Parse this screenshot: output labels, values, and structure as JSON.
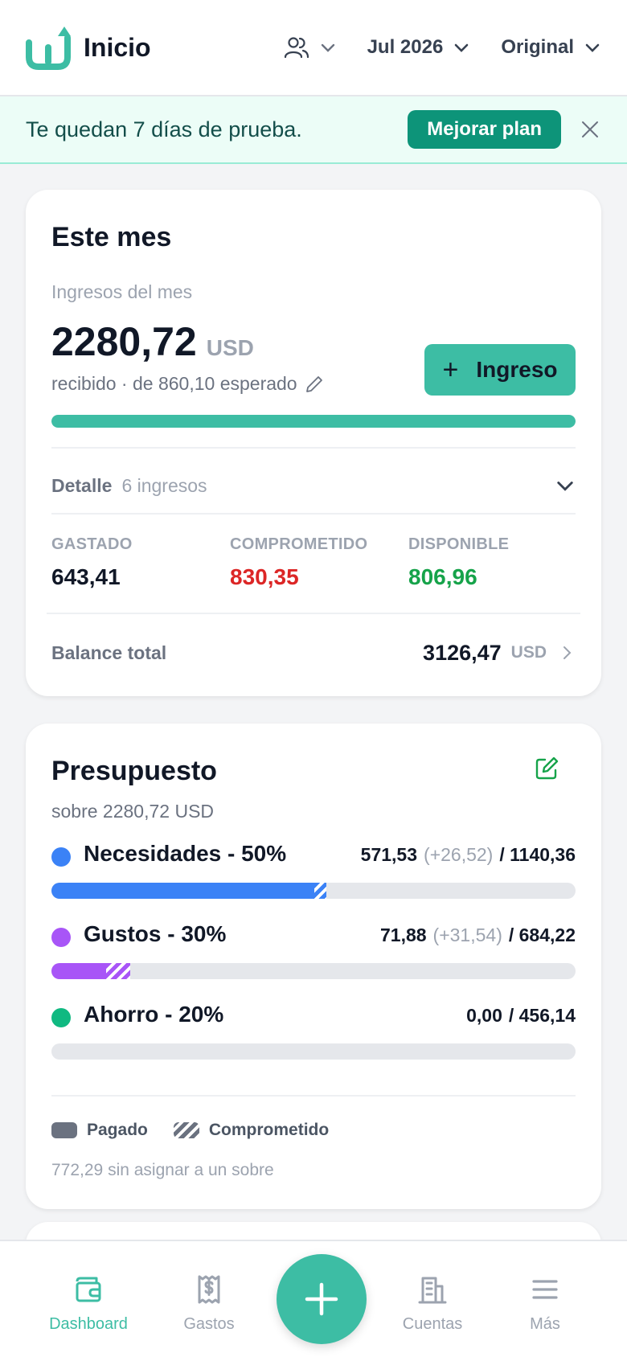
{
  "header": {
    "title": "Inicio",
    "month": "Jul 2026",
    "currency_mode": "Original"
  },
  "banner": {
    "message": "Te quedan 7 días de prueba.",
    "upgrade_label": "Mejorar plan"
  },
  "this_month": {
    "title": "Este mes",
    "income_label": "Ingresos del mes",
    "income_amount": "2280,72",
    "currency": "USD",
    "expected_text": "recibido · de 860,10 esperado",
    "income_button": "Ingreso",
    "progress_fraction": 1.0,
    "detail_label": "Detalle",
    "detail_count": "6 ingresos",
    "stats": [
      {
        "label": "GASTADO",
        "value": "643,41",
        "color": "#111827"
      },
      {
        "label": "COMPROMETIDO",
        "value": "830,35",
        "color": "#dc2626"
      },
      {
        "label": "DISPONIBLE",
        "value": "806,96",
        "color": "#16a34a"
      }
    ],
    "balance_label": "Balance total",
    "balance_value": "3126,47",
    "balance_currency": "USD"
  },
  "budget": {
    "title": "Presupuesto",
    "subtitle": "sobre 2280,72 USD",
    "items": [
      {
        "name": "Necesidades - 50%",
        "spent": "571,53",
        "committed": "(+26,52)",
        "total": "/ 1140,36",
        "color": "#3b82f6",
        "paid_fraction": 0.501,
        "committed_fraction": 0.023
      },
      {
        "name": "Gustos - 30%",
        "spent": "71,88",
        "committed": "(+31,54)",
        "total": "/ 684,22",
        "color": "#a855f7",
        "paid_fraction": 0.105,
        "committed_fraction": 0.046
      },
      {
        "name": "Ahorro - 20%",
        "spent": "0,00",
        "committed": "",
        "total": "/ 456,14",
        "color": "#10b981",
        "paid_fraction": 0.0,
        "committed_fraction": 0.0
      }
    ],
    "legend_paid": "Pagado",
    "legend_committed": "Comprometido",
    "unassigned": "772,29 sin asignar a un sobre"
  },
  "nav": {
    "dashboard": "Dashboard",
    "expenses": "Gastos",
    "accounts": "Cuentas",
    "more": "Más"
  },
  "colors": {
    "accent": "#3dbda4",
    "accent_dark": "#0d9479"
  }
}
